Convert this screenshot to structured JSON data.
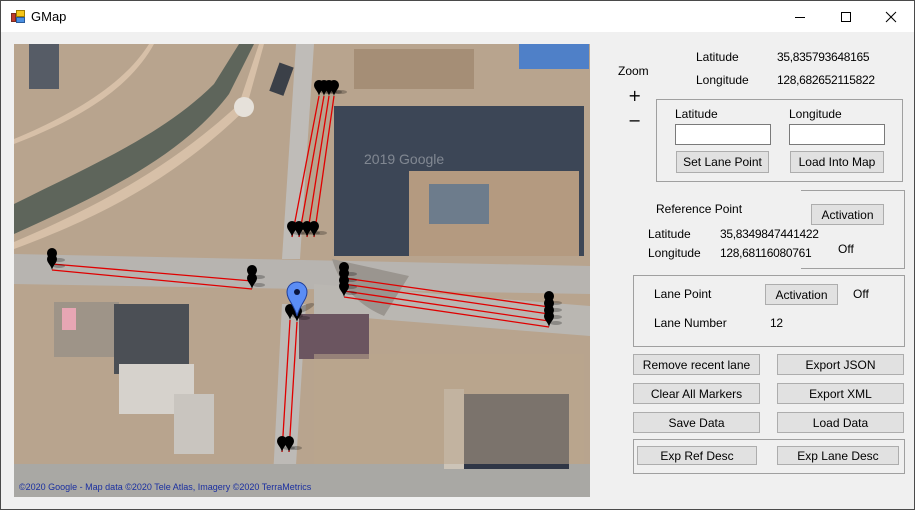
{
  "window": {
    "title": "GMap",
    "icon": "app-form-icon",
    "controls": {
      "minimize": "minimize-icon",
      "maximize": "maximize-icon",
      "close": "close-icon"
    }
  },
  "map": {
    "copyright": "©2020 Google - Map data ©2020 Tele Atlas, Imagery ©2020 TerraMetrics",
    "watermark": "2019 Google",
    "current_marker": "blue-location-pin",
    "lane_color": "#e00000",
    "marker_color": "#000000",
    "pin_color": "#5b8df5"
  },
  "zoom": {
    "label": "Zoom",
    "plus": "+",
    "minus": "−"
  },
  "current_position": {
    "latitude_label": "Latitude",
    "latitude_value": "35,835793648165",
    "longitude_label": "Longitude",
    "longitude_value": "128,682652115822"
  },
  "lane_input": {
    "latitude_label": "Latitude",
    "latitude_value": "",
    "longitude_label": "Longitude",
    "longitude_value": "",
    "set_lane_point_label": "Set Lane Point",
    "load_into_map_label": "Load Into Map"
  },
  "reference_point": {
    "title": "Reference Point",
    "activation_label": "Activation",
    "status": "Off",
    "latitude_label": "Latitude",
    "latitude_value": "35,8349847441422",
    "longitude_label": "Longitude",
    "longitude_value": "128,68116080761"
  },
  "lane_point": {
    "title": "Lane Point",
    "activation_label": "Activation",
    "status": "Off",
    "lane_number_label": "Lane Number",
    "lane_number_value": "12"
  },
  "actions": {
    "remove_recent_lane": "Remove recent lane",
    "export_json": "Export JSON",
    "clear_all_markers": "Clear All Markers",
    "export_xml": "Export XML",
    "save_data": "Save Data",
    "load_data": "Load Data",
    "exp_ref_desc": "Exp Ref Desc",
    "exp_lane_desc": "Exp Lane Desc"
  }
}
